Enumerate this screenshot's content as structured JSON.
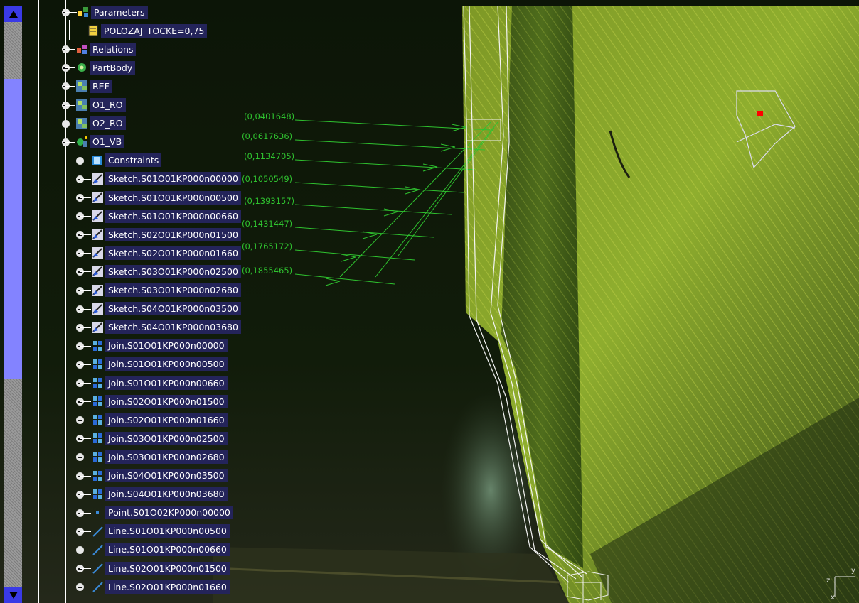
{
  "tree": {
    "items": [
      {
        "label": "Parameters",
        "icon": "parameters-icon"
      },
      {
        "label": "POLOZAJ_TOCKE=0,75",
        "icon": "formula-parameter-icon"
      },
      {
        "label": "Relations",
        "icon": "relations-icon"
      },
      {
        "label": "PartBody",
        "icon": "partbody-icon"
      },
      {
        "label": "REF",
        "icon": "geometrical-set-icon"
      },
      {
        "label": "O1_RO",
        "icon": "geometrical-set-icon"
      },
      {
        "label": "O2_RO",
        "icon": "geometrical-set-icon"
      },
      {
        "label": "O1_VB",
        "icon": "geometrical-set-active-icon"
      },
      {
        "label": "Constraints",
        "icon": "constraints-icon"
      },
      {
        "label": "Sketch.S01O01KP000n00000",
        "icon": "sketch-icon"
      },
      {
        "label": "Sketch.S01O01KP000n00500",
        "icon": "sketch-icon"
      },
      {
        "label": "Sketch.S01O01KP000n00660",
        "icon": "sketch-icon"
      },
      {
        "label": "Sketch.S02O01KP000n01500",
        "icon": "sketch-icon"
      },
      {
        "label": "Sketch.S02O01KP000n01660",
        "icon": "sketch-icon"
      },
      {
        "label": "Sketch.S03O01KP000n02500",
        "icon": "sketch-icon"
      },
      {
        "label": "Sketch.S03O01KP000n02680",
        "icon": "sketch-icon"
      },
      {
        "label": "Sketch.S04O01KP000n03500",
        "icon": "sketch-icon"
      },
      {
        "label": "Sketch.S04O01KP000n03680",
        "icon": "sketch-icon"
      },
      {
        "label": "Join.S01O01KP000n00000",
        "icon": "join-icon"
      },
      {
        "label": "Join.S01O01KP000n00500",
        "icon": "join-icon"
      },
      {
        "label": "Join.S01O01KP000n00660",
        "icon": "join-icon"
      },
      {
        "label": "Join.S02O01KP000n01500",
        "icon": "join-icon"
      },
      {
        "label": "Join.S02O01KP000n01660",
        "icon": "join-icon"
      },
      {
        "label": "Join.S03O01KP000n02500",
        "icon": "join-icon"
      },
      {
        "label": "Join.S03O01KP000n02680",
        "icon": "join-icon"
      },
      {
        "label": "Join.S04O01KP000n03500",
        "icon": "join-icon"
      },
      {
        "label": "Join.S04O01KP000n03680",
        "icon": "join-icon"
      },
      {
        "label": "Point.S01O02KP000n00000",
        "icon": "point-icon"
      },
      {
        "label": "Line.S01O01KP000n00500",
        "icon": "line-icon"
      },
      {
        "label": "Line.S01O01KP000n00660",
        "icon": "line-icon"
      },
      {
        "label": "Line.S02O01KP000n01500",
        "icon": "line-icon"
      },
      {
        "label": "Line.S02O01KP000n01660",
        "icon": "line-icon"
      }
    ]
  },
  "dimensions": [
    "(0,0401648)",
    "(0,0617636)",
    "(0,1134705)",
    "(0,1050549)",
    "(0,1393157)",
    "(0,1431447)",
    "(0,1765172)",
    "(0,1855465)"
  ],
  "axis": {
    "z": "z",
    "y": "y",
    "x": "x"
  },
  "colors": {
    "tree_label_bg": "#24245a",
    "dimension_green": "#2fc22f",
    "scrollbar_thumb": "#8383ff",
    "scrollbar_arrow": "#3a3ae6",
    "marker_red": "#ff0000"
  }
}
